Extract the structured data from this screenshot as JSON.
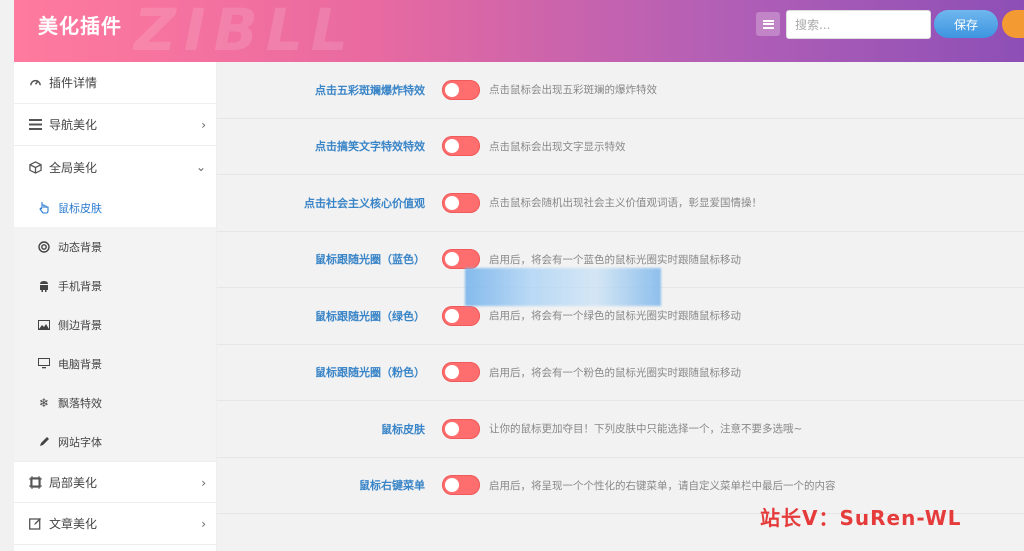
{
  "header": {
    "title": "美化插件",
    "watermark": "ZIBLL",
    "search_placeholder": "搜索...",
    "save_label": "保存"
  },
  "sidebar": {
    "items": [
      {
        "label": "插件详情",
        "icon": "gauge-icon"
      },
      {
        "label": "导航美化",
        "icon": "nav-icon"
      },
      {
        "label": "全局美化",
        "icon": "cube-icon"
      }
    ],
    "sub_items": [
      {
        "label": "鼠标皮肤",
        "icon": "hand-pointer-icon"
      },
      {
        "label": "动态背景",
        "icon": "lifebuoy-icon"
      },
      {
        "label": "手机背景",
        "icon": "android-icon"
      },
      {
        "label": "侧边背景",
        "icon": "image-icon"
      },
      {
        "label": "电脑背景",
        "icon": "desktop-icon"
      },
      {
        "label": "飘落特效",
        "icon": "snowflake-icon"
      },
      {
        "label": "网站字体",
        "icon": "pen-icon"
      }
    ],
    "bottom_items": [
      {
        "label": "局部美化",
        "icon": "frame-icon"
      },
      {
        "label": "文章美化",
        "icon": "edit-icon"
      }
    ]
  },
  "settings": [
    {
      "label": "点击五彩斑斓爆炸特效",
      "desc": "点击鼠标会出现五彩斑斓的爆炸特效"
    },
    {
      "label": "点击搞笑文字特效特效",
      "desc": "点击鼠标会出现文字显示特效"
    },
    {
      "label": "点击社会主义核心价值观",
      "desc": "点击鼠标会随机出现社会主义价值观词语，彰显爱国情操！"
    },
    {
      "label": "鼠标跟随光圈（蓝色）",
      "desc": "启用后，将会有一个蓝色的鼠标光圈实时跟随鼠标移动"
    },
    {
      "label": "鼠标跟随光圈（绿色）",
      "desc": "启用后，将会有一个绿色的鼠标光圈实时跟随鼠标移动"
    },
    {
      "label": "鼠标跟随光圈（粉色）",
      "desc": "启用后，将会有一个粉色的鼠标光圈实时跟随鼠标移动"
    },
    {
      "label": "鼠标皮肤",
      "desc": "让你的鼠标更加夺目！下列皮肤中只能选择一个，注意不要多选哦~"
    },
    {
      "label": "鼠标右键菜单",
      "desc": "启用后，将呈现一个个性化的右键菜单，请自定义菜单栏中最后一个的内容"
    }
  ],
  "overlay_text": "站长V：SuRen-WL",
  "colors": {
    "accent": "#3a85c8",
    "toggle": "#ff6e6e",
    "watermark": "#e53b3b"
  }
}
